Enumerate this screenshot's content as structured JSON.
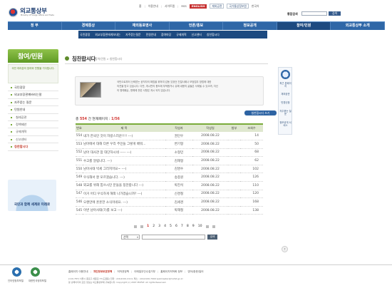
{
  "header": {
    "logo_text": "외교통상부",
    "logo_subtitle": "Ministry of Foreign Affairs and Trade",
    "utility_links": [
      "홈",
      "이용안내",
      "사이트맵",
      "RSS"
    ],
    "english_label": "ENGLISH",
    "extra_links": [
      "재외공관",
      "국가통상정보원",
      "한국어"
    ],
    "search_label": "통합검색",
    "search_button": "검색"
  },
  "main_nav": [
    "정 무",
    "경제통상",
    "재외동포영사",
    "언론/홍보",
    "정보공개",
    "참여/민원",
    "외교통상부 소개"
  ],
  "sub_nav": [
    "국민광장",
    "외교부장관에게보내는",
    "자주묻는질문",
    "민원안내",
    "칭찬합시다",
    "참여마당",
    "규제개혁",
    "신고센터",
    "칭찬합시다"
  ],
  "sidebar": {
    "title": "참여/민원",
    "description": "국민 여러분의 참여와 민원을 기다립니다.",
    "items": [
      {
        "label": "국민광장",
        "sub": false,
        "active": false
      },
      {
        "label": "외교부장관께바라는말",
        "sub": false,
        "active": false
      },
      {
        "label": "자주묻는 질문",
        "sub": false,
        "active": false
      },
      {
        "label": "민원안내",
        "sub": false,
        "active": false
      },
      {
        "label": "칠레공관",
        "sub": true,
        "active": false
      },
      {
        "label": "정책제안",
        "sub": true,
        "active": false
      },
      {
        "label": "규제개혁",
        "sub": true,
        "active": false
      },
      {
        "label": "신고센터",
        "sub": true,
        "active": false
      },
      {
        "label": "칭찬합시다",
        "sub": false,
        "active": true
      }
    ],
    "banner_text": "국민과 함께 세계로 미래로"
  },
  "content": {
    "page_title": "칭찬합시다",
    "breadcrumb": "홈 > 참여/민원 > 칭찬합시다",
    "breadcrumb_button": "목록으로",
    "intro_lines": [
      "국민으로부터 신뢰받는 공직자의 확립을 위하여 감동 있었던 친절사례나 모범업무 방법에 대한",
      "의견을 받고 있습니다. 다만, 게시판의 용도에 부적합거나 유해 내용의 글들은 삭제될 수 있으며, 자신",
      "의 명예훼손, 명예에 관련 사항은 게시 되지 않습니다."
    ],
    "count_prefix": "총 ",
    "count_total": "554",
    "count_middle": " 건 현재페이지 : ",
    "count_page": "1/56",
    "write_button": "칭찬합시다 쓰기",
    "table": {
      "headers": [
        "번호",
        "제 목",
        "작성자",
        "작성일",
        "첨부",
        "조회수"
      ],
      "rows": [
        [
          "554",
          "내가 한국인 것이 자랑스러운!!!! ---)",
          "권인우",
          "2008.08.22",
          "",
          "14"
        ],
        [
          "553",
          "남아에서 대해 다른 우리 주민들 그렇게 배워...",
          "변기형",
          "2008.08.22",
          "",
          "50"
        ],
        [
          "552",
          "남아 대사관 참 대단하시네 ----- ---)",
          "소형민",
          "2008.08.22",
          "",
          "68"
        ],
        [
          "551",
          "수고를 알립니다. ---)",
          "김해형",
          "2008.08.22",
          "",
          "62"
        ],
        [
          "550",
          "남아사태 빅세 그러지마요~ ---)",
          "김명수",
          "2008.08.22",
          "",
          "102"
        ],
        [
          "549",
          "우식해서 잘 모르겠습니다. ---)",
          "송종원",
          "2008.08.22",
          "",
          "126"
        ],
        [
          "548",
          "외교를 위해 힘쓰시던 분들을 칭찬합니다 ---)",
          "박진석",
          "2008.08.22",
          "",
          "110"
        ],
        [
          "547",
          "이거 어디 우식하게 해외 나가겠습니까? ---)",
          "신경철",
          "2008.08.22",
          "",
          "120"
        ],
        [
          "546",
          "오랜만에 훈훈한 소식이네요. ---)",
          "김세경",
          "2008.08.22",
          "",
          "168"
        ],
        [
          "545",
          "이번 남아사태(7)를 보고 ---)",
          "박해철",
          "2008.08.22",
          "",
          "138"
        ]
      ]
    },
    "pages": [
      "1",
      "2",
      "3",
      "4",
      "5",
      "6",
      "7",
      "8",
      "9",
      "10"
    ],
    "current_page": "1",
    "search_select": "선택",
    "search_button": "검색"
  },
  "quick_menu": {
    "items": [
      "최근 본페이지",
      "재외공관",
      "민원신청",
      "자주묻는 질문",
      "정보공개 서비스"
    ],
    "top_button": "↑"
  },
  "footer": {
    "badge1_label": "인터넷정부포털",
    "badge2_label": "대한민국정부포털",
    "links": [
      "홈페이지 이용안내",
      "개인정보보호정책",
      "저작권정책",
      "이메일무단수집거부",
      "홈페이지최적화 정보",
      "영어/중문/일어"
    ],
    "highlight_link_index": 1,
    "address_lines": [
      "[110-787] 서울시 종로구 세종로 37(도렴동)  전화 : (02)2100-2114, 팩스 : (02)2100-7999  webmaster@mofat.go.kr",
      "본 홈페이지의 모든 정보는 외교통상부에 귀속됩니다. Copyright (c) 2007 MOFAT. All rights Reserved."
    ]
  },
  "colors": {
    "primary_blue": "#2f67a7",
    "green": "#7aab3a",
    "accent_red": "#d0302c"
  }
}
